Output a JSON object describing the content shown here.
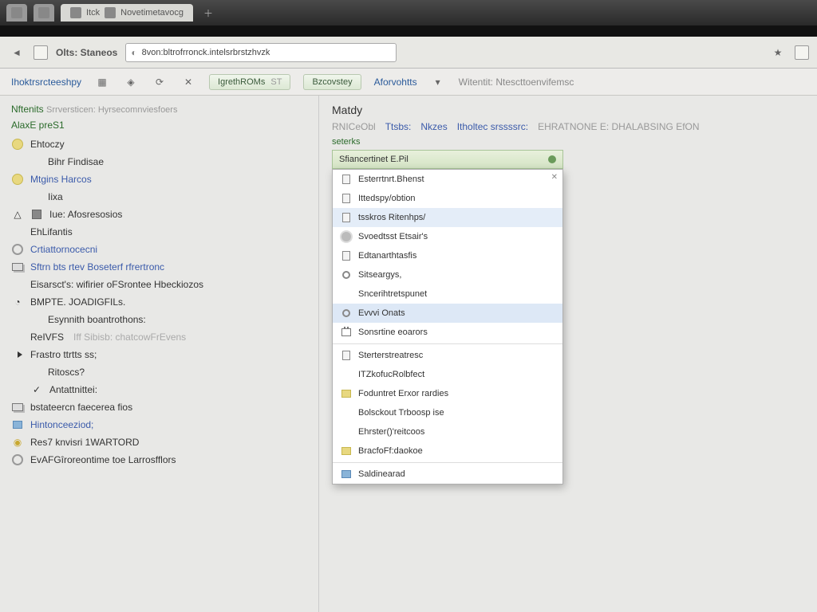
{
  "titlebar": {
    "tabs": [
      {
        "label": ""
      },
      {
        "label": "Itck"
      },
      {
        "label": "Novetimetavocg"
      }
    ]
  },
  "toolbar": {
    "label": "Olts: Staneos",
    "url": "8von:bltrofrronck.intelsrbrstzhvzk"
  },
  "subtoolbar": {
    "brand": "Ihoktrsrcteeshpy",
    "button1": "IgrethROMs",
    "button1_badge": "ST",
    "button2": "Bzcovstey",
    "link1": "Aforvohtts",
    "text1": "Witentit: Ntescttoenvifemsc"
  },
  "sidebar": {
    "header": "Nftenits",
    "header_sub": "Srrversticen: Hyrsecomnviesfoers",
    "section": "AlaxE preS1",
    "items": [
      {
        "icon": "circ-y",
        "label": "Ehtoczy",
        "link": false
      },
      {
        "icon": "",
        "label": "Bihr Findisae",
        "link": false,
        "indent": true
      },
      {
        "icon": "circ-y",
        "label": "Mtgins Harcos",
        "link": true
      },
      {
        "icon": "",
        "label": "Iixa",
        "link": false,
        "indent": true
      },
      {
        "icon": "sq-g",
        "label": "Iue: Afosresosios",
        "link": false,
        "pre": "tri"
      },
      {
        "icon": "",
        "label": "EhLifantis",
        "link": false
      },
      {
        "icon": "circ-o",
        "label": "Crtiattornocecni",
        "link": true
      },
      {
        "icon": "stack-i",
        "label": "Sftrn bts rtev Boseterf rfrertronc",
        "link": true
      },
      {
        "icon": "",
        "label": "Eisarsct's: wifirier oFSrontee Hbeckiozos",
        "link": false
      },
      {
        "icon": "ring",
        "label": "BMPTE. JOADIGFILs.",
        "link": false
      },
      {
        "icon": "",
        "label": "Esynnith boantrothons:",
        "link": false,
        "indent": true
      },
      {
        "icon": "",
        "label": "ReIVFS",
        "link": false,
        "sub": "Iff Sibisb: chatcowFrEvens"
      },
      {
        "icon": "flag",
        "label": "Frastro ttrtts ss;",
        "link": false
      },
      {
        "icon": "",
        "label": "Ritoscs?",
        "link": false,
        "indent": true
      },
      {
        "icon": "",
        "label": "Antattnittei:",
        "link": false,
        "check": true
      },
      {
        "icon": "stack-i",
        "label": "bstateercn faecerea fios",
        "link": false
      },
      {
        "icon": "blue",
        "label": "Hintonceeziod;",
        "link": true
      },
      {
        "icon": "ring-y",
        "label": "Res7 knvisri 1WARTORD",
        "link": false
      },
      {
        "icon": "circ-o",
        "label": "EvAFGîroreontime toe Larrosfflors",
        "link": false
      }
    ]
  },
  "main": {
    "title": "Matdy",
    "tabrow": {
      "t0": "RNICeObl",
      "t1": "Ttsbs:",
      "t2": "Nkzes",
      "t3": "Itholtec srssssrc:",
      "t4": "EHRATNONE E: DHALABSING EfON"
    },
    "sub": "seterks",
    "dropdown": {
      "selected": "Sfiancertinet E.Pil",
      "items": [
        {
          "icon": "doc",
          "label": "Esterrtnrt.Bhenst"
        },
        {
          "icon": "doc",
          "label": "Ittedspy/obtion"
        },
        {
          "icon": "doc",
          "label": "tsskros Ritenhps/",
          "sel": true
        },
        {
          "icon": "gear",
          "label": "Svoedtsst Etsair's"
        },
        {
          "icon": "doc",
          "label": "Edtanarthtasfis"
        },
        {
          "icon": "ring",
          "label": "Sitseargys,"
        },
        {
          "icon": "",
          "label": "Sncerihtretspunet"
        },
        {
          "icon": "ring",
          "label": "Evvvi Onats",
          "hl": true
        },
        {
          "icon": "cal",
          "label": "Sonsrtine eoarors"
        },
        {
          "sep": true
        },
        {
          "icon": "doc",
          "label": "Sterterstreatresc"
        },
        {
          "icon": "",
          "label": "ITZkofucRolbfect"
        },
        {
          "icon": "fold",
          "label": "Foduntret Erxor rardies"
        },
        {
          "icon": "",
          "label": "Bolsckout Trboosp ise"
        },
        {
          "icon": "",
          "label": "Ehrster()'reitcoos"
        },
        {
          "icon": "fold",
          "label": "BracfoFf:daokoe"
        },
        {
          "sep": true
        },
        {
          "icon": "blue",
          "label": "Saldinearad"
        }
      ]
    }
  }
}
